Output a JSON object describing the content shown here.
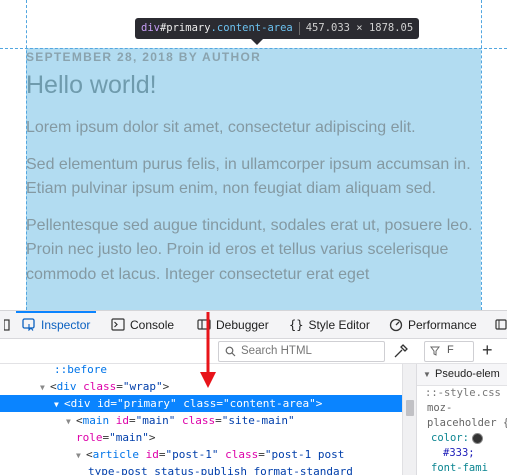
{
  "page": {
    "tooltip": {
      "tag": "div",
      "id": "#primary",
      "class": ".content-area",
      "dimensions": "457.033 × 1878.05"
    },
    "meta": "SEPTEMBER 28, 2018 BY AUTHOR",
    "title": "Hello world!",
    "paragraphs": [
      "Lorem ipsum dolor sit amet, consectetur adipiscing elit.",
      "Sed elementum purus felis, in ullamcorper ipsum accumsan in. Etiam pulvinar ipsum enim, non feugiat diam aliquam sed.",
      "Pellentesque sed augue tincidunt, sodales erat ut, posuere leo. Proin nec justo leo. Proin id eros et tellus varius scelerisque commodo et lacus. Integer consectetur erat eget"
    ],
    "colors": {
      "highlight": "#b2dcf1",
      "guide": "#52a6e0"
    }
  },
  "devtools": {
    "tabs": {
      "inspector": "Inspector",
      "console": "Console",
      "debugger": "Debugger",
      "style_editor": "Style Editor",
      "performance": "Performance"
    },
    "search_placeholder": "Search HTML",
    "filter_label": "F",
    "add_rule": "+",
    "markup": {
      "before": "::before",
      "wrap_tag": "div",
      "wrap_attr": "class",
      "wrap_val": "\"wrap\"",
      "primary_tag": "div",
      "primary_id_attr": "id",
      "primary_id_val": "\"primary\"",
      "primary_class_attr": "class",
      "primary_class_val": "\"content-area\"",
      "main_tag": "main",
      "main_id_attr": "id",
      "main_id_val": "\"main\"",
      "main_class_attr": "class",
      "main_class_val": "\"site-main\"",
      "main_role_attr": "role",
      "main_role_val": "\"main\"",
      "article_tag": "article",
      "article_id_attr": "id",
      "article_id_val": "\"post-1\"",
      "article_class_attr": "class",
      "article_class_val_1": "\"post-1 post",
      "article_class_val_2": "type-post status-publish format-standard"
    },
    "rules": {
      "header": "Pseudo-elem",
      "source": "::-style.css",
      "selector_1": "moz-",
      "selector_2": "placeholder {",
      "prop_color": "color:",
      "val_color": "#333;",
      "prop_font": "font-fami"
    }
  }
}
